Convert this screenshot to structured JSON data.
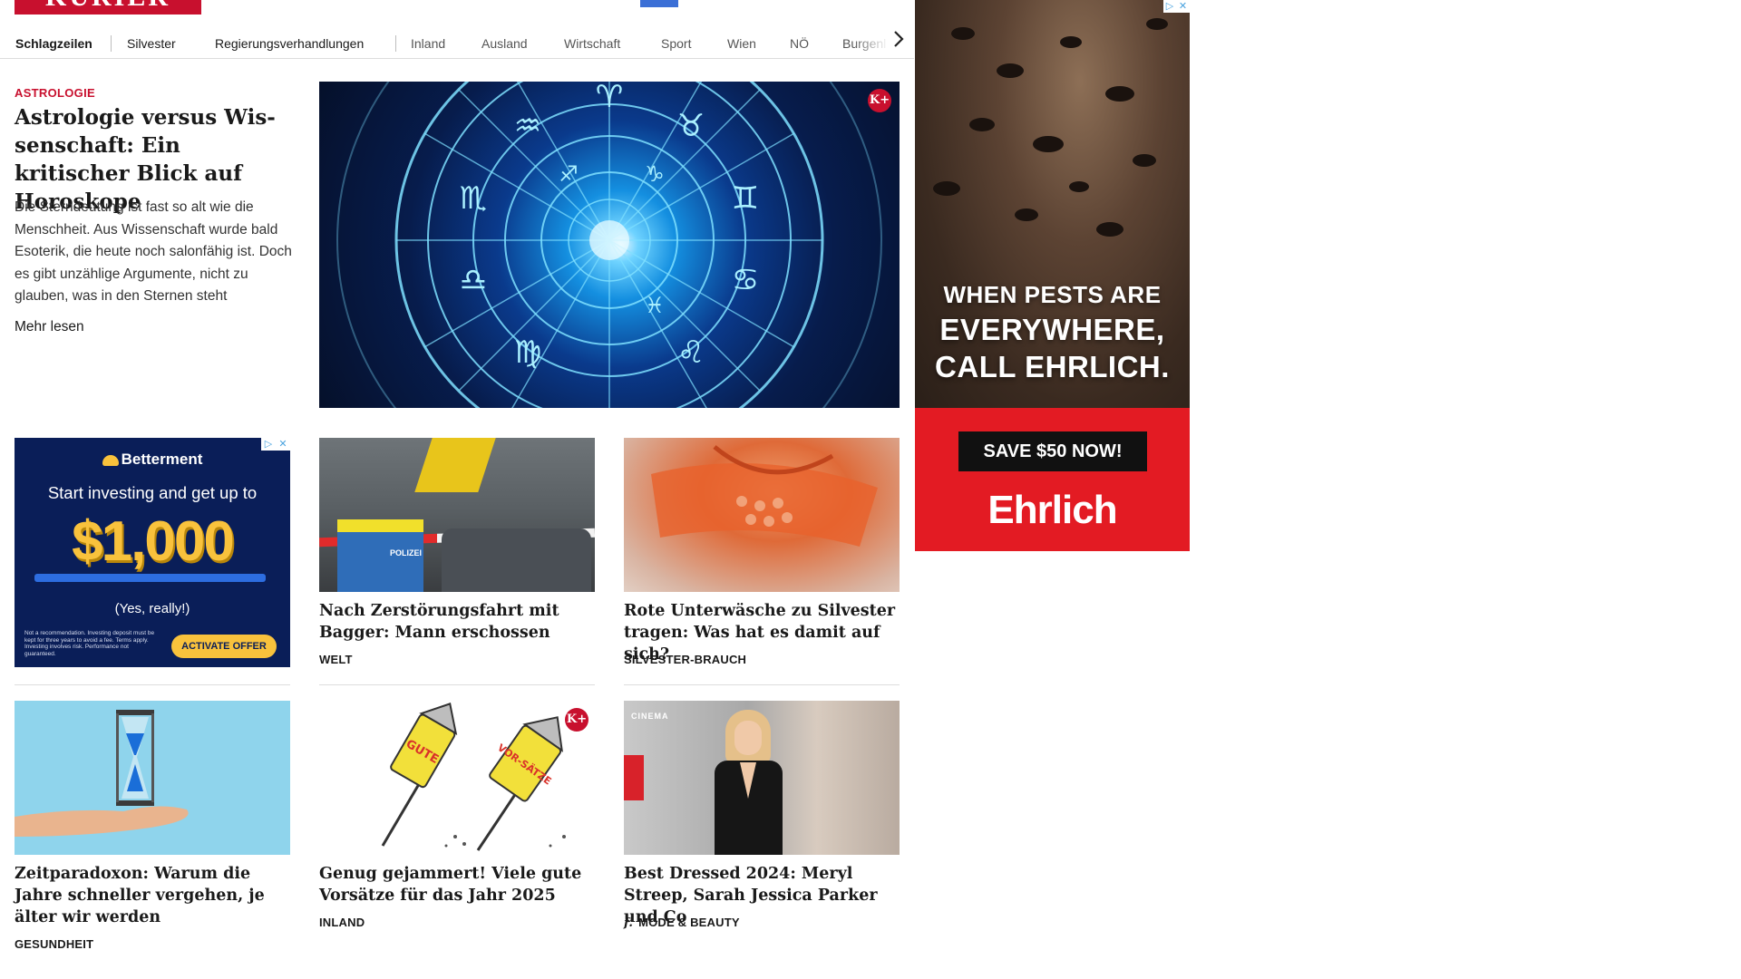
{
  "header": {
    "logo_text": "KURIER",
    "nav": [
      "Schlagzeilen",
      "Silvester",
      "Regierungsverhandlungen",
      "Inland",
      "Ausland",
      "Wirtschaft",
      "Sport",
      "Wien",
      "NÖ",
      "Burgenl"
    ]
  },
  "lead": {
    "kicker": "ASTROLOGIE",
    "title": "Astrologie versus Wis­senschaft: Ein kritischer Blick auf Horoskope",
    "teaser": "Die Sterndeutung ist fast so alt wie die Menschheit. Aus Wissenschaft wurde bald Esoterik, die heute noch salonfähig ist. Doch es gibt unzählige Argumente, nicht zu glauben, was in den Sternen steht",
    "more": "Mehr lesen",
    "badge": "K+"
  },
  "ad_betterment": {
    "brand": "Betterment",
    "headline": "Start investing and get up to",
    "amount": "$1,000",
    "sub": "(Yes, really!)",
    "fine_print": "Not a recommendation. Investing deposit must be kept for three years to avoid a fee. Terms apply. Investing involves risk. Performance not guaranteed.",
    "cta": "ACTIVATE OFFER"
  },
  "cards": [
    {
      "title": "Nach Zerstörungsfahrt mit Bagger: Mann erschossen",
      "category": "WELT",
      "img_text": "POLIZEI"
    },
    {
      "title": "Rote Unterwäsche zu Silvester tra­gen: Was hat es damit auf sich?",
      "category": "SILVESTER-BRAUCH"
    },
    {
      "title": "Zeitparadoxon: Warum die Jahre schneller vergehen, je älter wir werden",
      "category": "GESUNDHEIT"
    },
    {
      "title": "Genug gejammert! Viele gute Vor­sätze für das Jahr 2025",
      "category": "INLAND",
      "badge": "K+",
      "img_words": [
        "GUTE",
        "VOR-SÄTZE"
      ]
    },
    {
      "title": "Best Dressed 2024: Meryl Streep, Sarah Jessica Parker und Co",
      "category": "MODE & BEAUTY",
      "category_prefix": "f.",
      "img_text": "CINEMA"
    }
  ],
  "ad_right": {
    "line1": "WHEN PESTS ARE",
    "line2": "EVERYWHERE,",
    "line3": "CALL EHRLICH.",
    "cta": "SAVE $50 NOW!",
    "brand": "Ehrlich"
  },
  "ad_controls": {
    "adchoices": "▷",
    "close": "✕"
  }
}
